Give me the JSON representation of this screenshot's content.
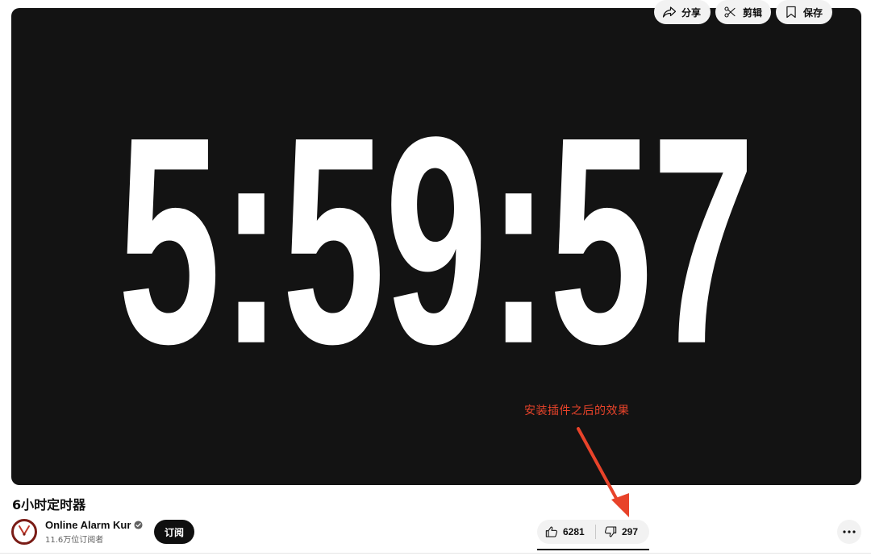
{
  "player": {
    "timer_text": "5:59:57",
    "background_color": "#131313",
    "digit_color": "#ffffff"
  },
  "annotation": {
    "text": "安装插件之后的效果",
    "color": "#e8432a"
  },
  "video": {
    "title": "6小时定时器"
  },
  "channel": {
    "name": "Online Alarm Kur",
    "subscribers": "11.6万位订阅者",
    "verified_icon": "verified-check-icon",
    "avatar_icon": "clock-logo-icon"
  },
  "actions": {
    "subscribe_label": "订阅",
    "like_count": "6281",
    "dislike_count": "297",
    "share_label": "分享",
    "clip_label": "剪辑",
    "save_label": "保存",
    "like_icon": "thumbs-up-icon",
    "dislike_icon": "thumbs-down-icon",
    "share_icon": "share-arrow-icon",
    "clip_icon": "scissors-icon",
    "save_icon": "bookmark-icon",
    "more_icon": "more-horizontal-icon"
  }
}
